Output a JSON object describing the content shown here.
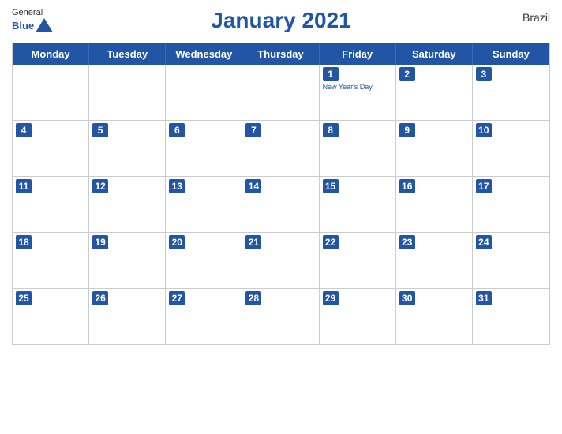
{
  "header": {
    "title": "January 2021",
    "country": "Brazil",
    "logo_general": "General",
    "logo_blue": "Blue"
  },
  "days_of_week": [
    "Monday",
    "Tuesday",
    "Wednesday",
    "Thursday",
    "Friday",
    "Saturday",
    "Sunday"
  ],
  "weeks": [
    [
      {
        "date": "",
        "events": []
      },
      {
        "date": "",
        "events": []
      },
      {
        "date": "",
        "events": []
      },
      {
        "date": "",
        "events": []
      },
      {
        "date": "1",
        "events": [
          "New Year's Day"
        ]
      },
      {
        "date": "2",
        "events": []
      },
      {
        "date": "3",
        "events": []
      }
    ],
    [
      {
        "date": "4",
        "events": []
      },
      {
        "date": "5",
        "events": []
      },
      {
        "date": "6",
        "events": []
      },
      {
        "date": "7",
        "events": []
      },
      {
        "date": "8",
        "events": []
      },
      {
        "date": "9",
        "events": []
      },
      {
        "date": "10",
        "events": []
      }
    ],
    [
      {
        "date": "11",
        "events": []
      },
      {
        "date": "12",
        "events": []
      },
      {
        "date": "13",
        "events": []
      },
      {
        "date": "14",
        "events": []
      },
      {
        "date": "15",
        "events": []
      },
      {
        "date": "16",
        "events": []
      },
      {
        "date": "17",
        "events": []
      }
    ],
    [
      {
        "date": "18",
        "events": []
      },
      {
        "date": "19",
        "events": []
      },
      {
        "date": "20",
        "events": []
      },
      {
        "date": "21",
        "events": []
      },
      {
        "date": "22",
        "events": []
      },
      {
        "date": "23",
        "events": []
      },
      {
        "date": "24",
        "events": []
      }
    ],
    [
      {
        "date": "25",
        "events": []
      },
      {
        "date": "26",
        "events": []
      },
      {
        "date": "27",
        "events": []
      },
      {
        "date": "28",
        "events": []
      },
      {
        "date": "29",
        "events": []
      },
      {
        "date": "30",
        "events": []
      },
      {
        "date": "31",
        "events": []
      }
    ]
  ]
}
